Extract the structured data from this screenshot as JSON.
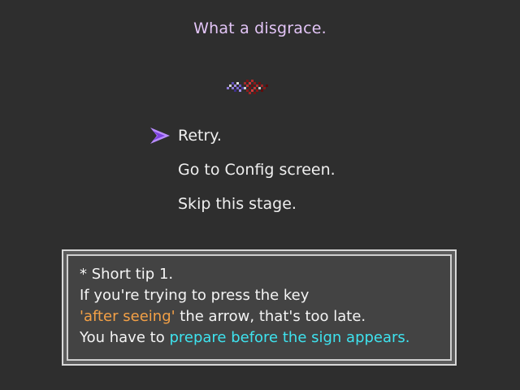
{
  "screen": {
    "title": "What a disgrace."
  },
  "menu": {
    "items": [
      {
        "label": "Retry.",
        "selected": true
      },
      {
        "label": "Go to Config screen.",
        "selected": false
      },
      {
        "label": "Skip this stage.",
        "selected": false
      }
    ],
    "cursor_icon": "arrow-cursor-icon"
  },
  "tip": {
    "line1": "* Short tip 1.",
    "line2": "If you're trying to press the key",
    "line3_highlight": "'after seeing'",
    "line3_rest": " the arrow, that's too late.",
    "line4_prefix": "You have to ",
    "line4_highlight": "prepare before the sign appears."
  },
  "colors": {
    "background": "#2e2e2e",
    "title": "#e2c4f6",
    "menu_text": "#efefef",
    "cursor": "#9a5cf3",
    "highlight_orange": "#f3a046",
    "highlight_cyan": "#3ee3ef"
  }
}
